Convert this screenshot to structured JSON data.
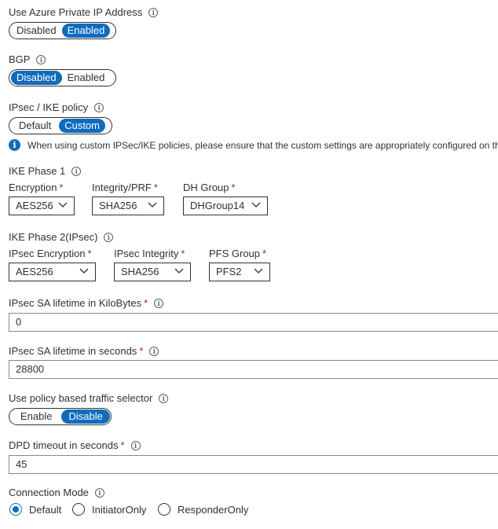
{
  "private_ip": {
    "label": "Use Azure Private IP Address",
    "options": [
      "Disabled",
      "Enabled"
    ],
    "selected": "Enabled"
  },
  "bgp": {
    "label": "BGP",
    "options": [
      "Disabled",
      "Enabled"
    ],
    "selected": "Disabled"
  },
  "ipsec_policy": {
    "label": "IPsec / IKE policy",
    "options": [
      "Default",
      "Custom"
    ],
    "selected": "Custom"
  },
  "notice": {
    "text": "When using custom IPSec/IKE policies, please ensure that the custom settings are appropriately configured on the"
  },
  "ike_phase1": {
    "title": "IKE Phase 1",
    "encryption": {
      "label": "Encryption",
      "value": "AES256"
    },
    "integrity": {
      "label": "Integrity/PRF",
      "value": "SHA256"
    },
    "dh_group": {
      "label": "DH Group",
      "value": "DHGroup14"
    }
  },
  "ike_phase2": {
    "title": "IKE Phase 2(IPsec)",
    "encryption": {
      "label": "IPsec Encryption",
      "value": "AES256"
    },
    "integrity": {
      "label": "IPsec Integrity",
      "value": "SHA256"
    },
    "pfs_group": {
      "label": "PFS Group",
      "value": "PFS2"
    }
  },
  "sa_kilobytes": {
    "label": "IPsec SA lifetime in KiloBytes",
    "value": "0"
  },
  "sa_seconds": {
    "label": "IPsec SA lifetime in seconds",
    "value": "28800"
  },
  "traffic_selector": {
    "label": "Use policy based traffic selector",
    "options": [
      "Enable",
      "Disable"
    ],
    "selected": "Disable"
  },
  "dpd_timeout": {
    "label": "DPD timeout in seconds",
    "value": "45"
  },
  "connection_mode": {
    "label": "Connection Mode",
    "options": [
      "Default",
      "InitiatorOnly",
      "ResponderOnly"
    ],
    "selected": "Default"
  },
  "required_marker": "*",
  "colors": {
    "accent": "#0f6cbd",
    "required": "#a4262c"
  },
  "icons": {
    "info": "info-icon",
    "notice": "info-filled-icon",
    "dropdown": "chevron-down-icon"
  }
}
